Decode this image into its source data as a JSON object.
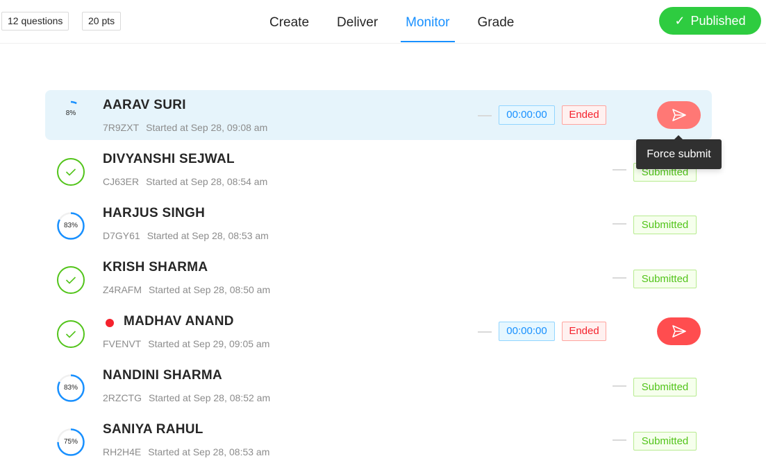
{
  "header": {
    "questions": "12 questions",
    "points": "20 pts",
    "tabs": [
      "Create",
      "Deliver",
      "Monitor",
      "Grade"
    ],
    "active_tab": "Monitor",
    "published_label": "Published",
    "published_icon": "check-icon"
  },
  "tooltip": "Force submit",
  "students": [
    {
      "name": "AARAV SURI",
      "code": "7R9ZXT",
      "started": "Started at Sep 28, 09:08 am",
      "progress_text": "8%",
      "progress": 0.08,
      "status": "in-progress",
      "timer": "00:00:00",
      "state": "Ended",
      "flagged": false
    },
    {
      "name": "DIVYANSHI SEJWAL",
      "code": "CJ63ER",
      "started": "Started at Sep 28, 08:54 am",
      "progress_text": "",
      "progress": 1,
      "status": "complete",
      "state": "Submitted",
      "flagged": false
    },
    {
      "name": "HARJUS SINGH",
      "code": "D7GY61",
      "started": "Started at Sep 28, 08:53 am",
      "progress_text": "83%",
      "progress": 0.83,
      "status": "partial",
      "state": "Submitted",
      "flagged": false
    },
    {
      "name": "KRISH SHARMA",
      "code": "Z4RAFM",
      "started": "Started at Sep 28, 08:50 am",
      "progress_text": "",
      "progress": 1,
      "status": "complete",
      "state": "Submitted",
      "flagged": false
    },
    {
      "name": "MADHAV ANAND",
      "code": "FVENVT",
      "started": "Started at Sep 29, 09:05 am",
      "progress_text": "",
      "progress": 1,
      "status": "complete",
      "timer": "00:00:00",
      "state": "Ended",
      "flagged": true
    },
    {
      "name": "NANDINI SHARMA",
      "code": "2RZCTG",
      "started": "Started at Sep 28, 08:52 am",
      "progress_text": "83%",
      "progress": 0.83,
      "status": "partial",
      "state": "Submitted",
      "flagged": false
    },
    {
      "name": "SANIYA RAHUL",
      "code": "RH2H4E",
      "started": "Started at Sep 28, 08:53 am",
      "progress_text": "75%",
      "progress": 0.75,
      "status": "partial",
      "state": "Submitted",
      "flagged": false
    }
  ],
  "colors": {
    "accent": "#1890ff",
    "success": "#52c41a",
    "published": "#2ecc40",
    "danger": "#ff4d4f",
    "highlight_row": "#e6f4fb"
  }
}
